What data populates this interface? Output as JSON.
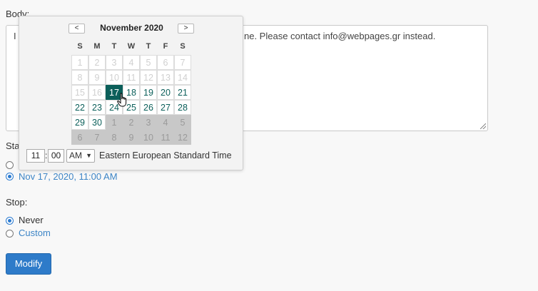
{
  "form": {
    "body_label": "Body:",
    "body_visible_start": "I",
    "body_visible_text": "ne. Please contact info@webpages.gr instead.",
    "start_label": "Sta",
    "start_selected_option": "Nov 17, 2020, 11:00 AM",
    "stop_label": "Stop:",
    "stop_options": [
      "Never",
      "Custom"
    ],
    "modify_button": "Modify"
  },
  "datepicker": {
    "prev_icon": "chevron-left-icon",
    "next_icon": "chevron-right-icon",
    "prev_symbol": "<",
    "next_symbol": ">",
    "title": "November 2020",
    "weekdays": [
      "S",
      "M",
      "T",
      "W",
      "T",
      "F",
      "S"
    ],
    "weeks": [
      [
        "1",
        "2",
        "3",
        "4",
        "5",
        "6",
        "7"
      ],
      [
        "8",
        "9",
        "10",
        "11",
        "12",
        "13",
        "14"
      ],
      [
        "15",
        "16",
        "17",
        "18",
        "19",
        "20",
        "21"
      ],
      [
        "22",
        "23",
        "24",
        "25",
        "26",
        "27",
        "28"
      ],
      [
        "29",
        "30",
        "1",
        "2",
        "3",
        "4",
        "5"
      ],
      [
        "6",
        "7",
        "8",
        "9",
        "10",
        "11",
        "12"
      ]
    ],
    "selected_day": "17",
    "hour": "11",
    "time_sep": ":",
    "minute": "00",
    "ampm": "AM",
    "timezone": "Eastern European Standard Time"
  },
  "colors": {
    "accent": "#0b5f5a",
    "button": "#2e7bc9",
    "link": "#3d85c6"
  }
}
